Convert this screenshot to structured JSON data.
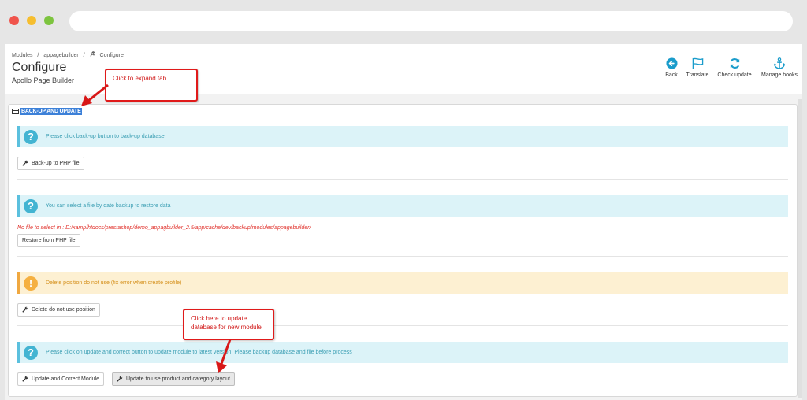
{
  "breadcrumb": {
    "modules": "Modules",
    "sep1": "/",
    "appagebuilder": "appagebuilder",
    "sep2": "/",
    "configure": "Configure"
  },
  "header": {
    "title": "Configure",
    "subtitle": "Apollo Page Builder"
  },
  "toolbar": {
    "back": "Back",
    "translate": "Translate",
    "check_update": "Check update",
    "manage_hooks": "Manage hooks",
    "icon_color": "#1a9ccb"
  },
  "panel": {
    "title": "BACK-UP AND UPDATE",
    "sections": [
      {
        "alert": "Please click back-up button to back-up database",
        "button": "Back-up to PHP file"
      },
      {
        "alert": "You can select a file by date backup to restore data",
        "error": "No file to select in : D:/xamp/htdocs/prestashop/demo_appagbuilder_2.5/app/cache/dev/backup/modules/appagebuilder/",
        "button": "Restore from PHP file"
      },
      {
        "alert": "Delete position do not use (fix error when create profile)",
        "button": "Delete do not use position"
      },
      {
        "alert": "Please click on update and correct button to update module to latest version. Please backup database and file before process",
        "button": "Update and Correct Module",
        "button2": "Update to use product and category layout"
      }
    ]
  },
  "callouts": {
    "expand": "Click to expand tab",
    "update": "Click here to update database for new module"
  },
  "icons": {
    "question": "?",
    "warning": "!",
    "wrench": "🔧"
  }
}
